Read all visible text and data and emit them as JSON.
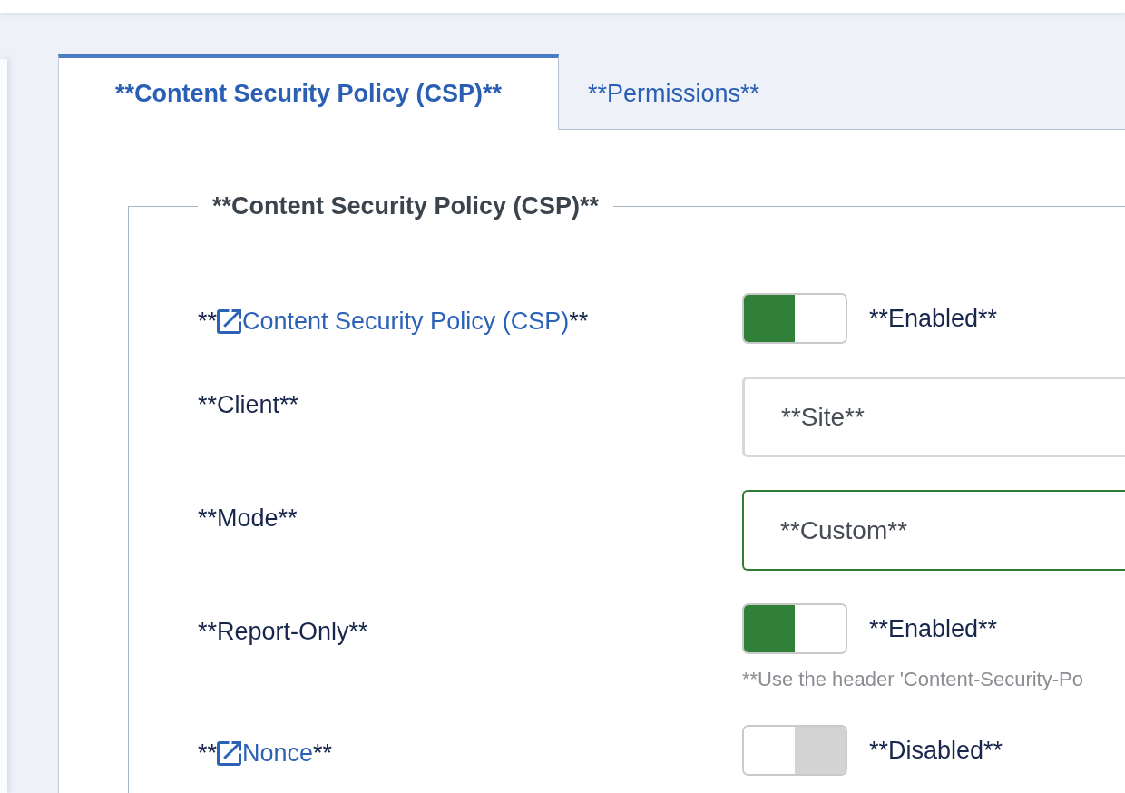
{
  "tabs": [
    {
      "label": "**Content Security Policy (CSP)**",
      "selected": true
    },
    {
      "label": "**Permissions**",
      "selected": false
    }
  ],
  "fieldset": {
    "legend": "**Content Security Policy (CSP)**",
    "rows": [
      {
        "kind": "switch",
        "label": [
          {
            "kind": "text",
            "text": "**"
          },
          {
            "kind": "link",
            "text": "Content Security Policy (CSP)"
          },
          {
            "kind": "text",
            "text": "**"
          }
        ],
        "on": true,
        "status": "**Enabled**"
      },
      {
        "kind": "select",
        "label": [
          {
            "kind": "text",
            "text": "**Client**"
          }
        ],
        "value": "**Site**",
        "valid": false
      },
      {
        "kind": "select",
        "label": [
          {
            "kind": "text",
            "text": "**Mode**"
          }
        ],
        "value": "**Custom**",
        "valid": true
      },
      {
        "kind": "switch",
        "label": [
          {
            "kind": "text",
            "text": "**Report-Only**"
          }
        ],
        "on": true,
        "status": "**Enabled**",
        "help": "**Use the header 'Content-Security-Po"
      },
      {
        "kind": "switch",
        "label": [
          {
            "kind": "text",
            "text": "**"
          },
          {
            "kind": "link",
            "text": "Nonce"
          },
          {
            "kind": "text",
            "text": "**"
          }
        ],
        "on": false,
        "status": "**Disabled**"
      }
    ]
  }
}
